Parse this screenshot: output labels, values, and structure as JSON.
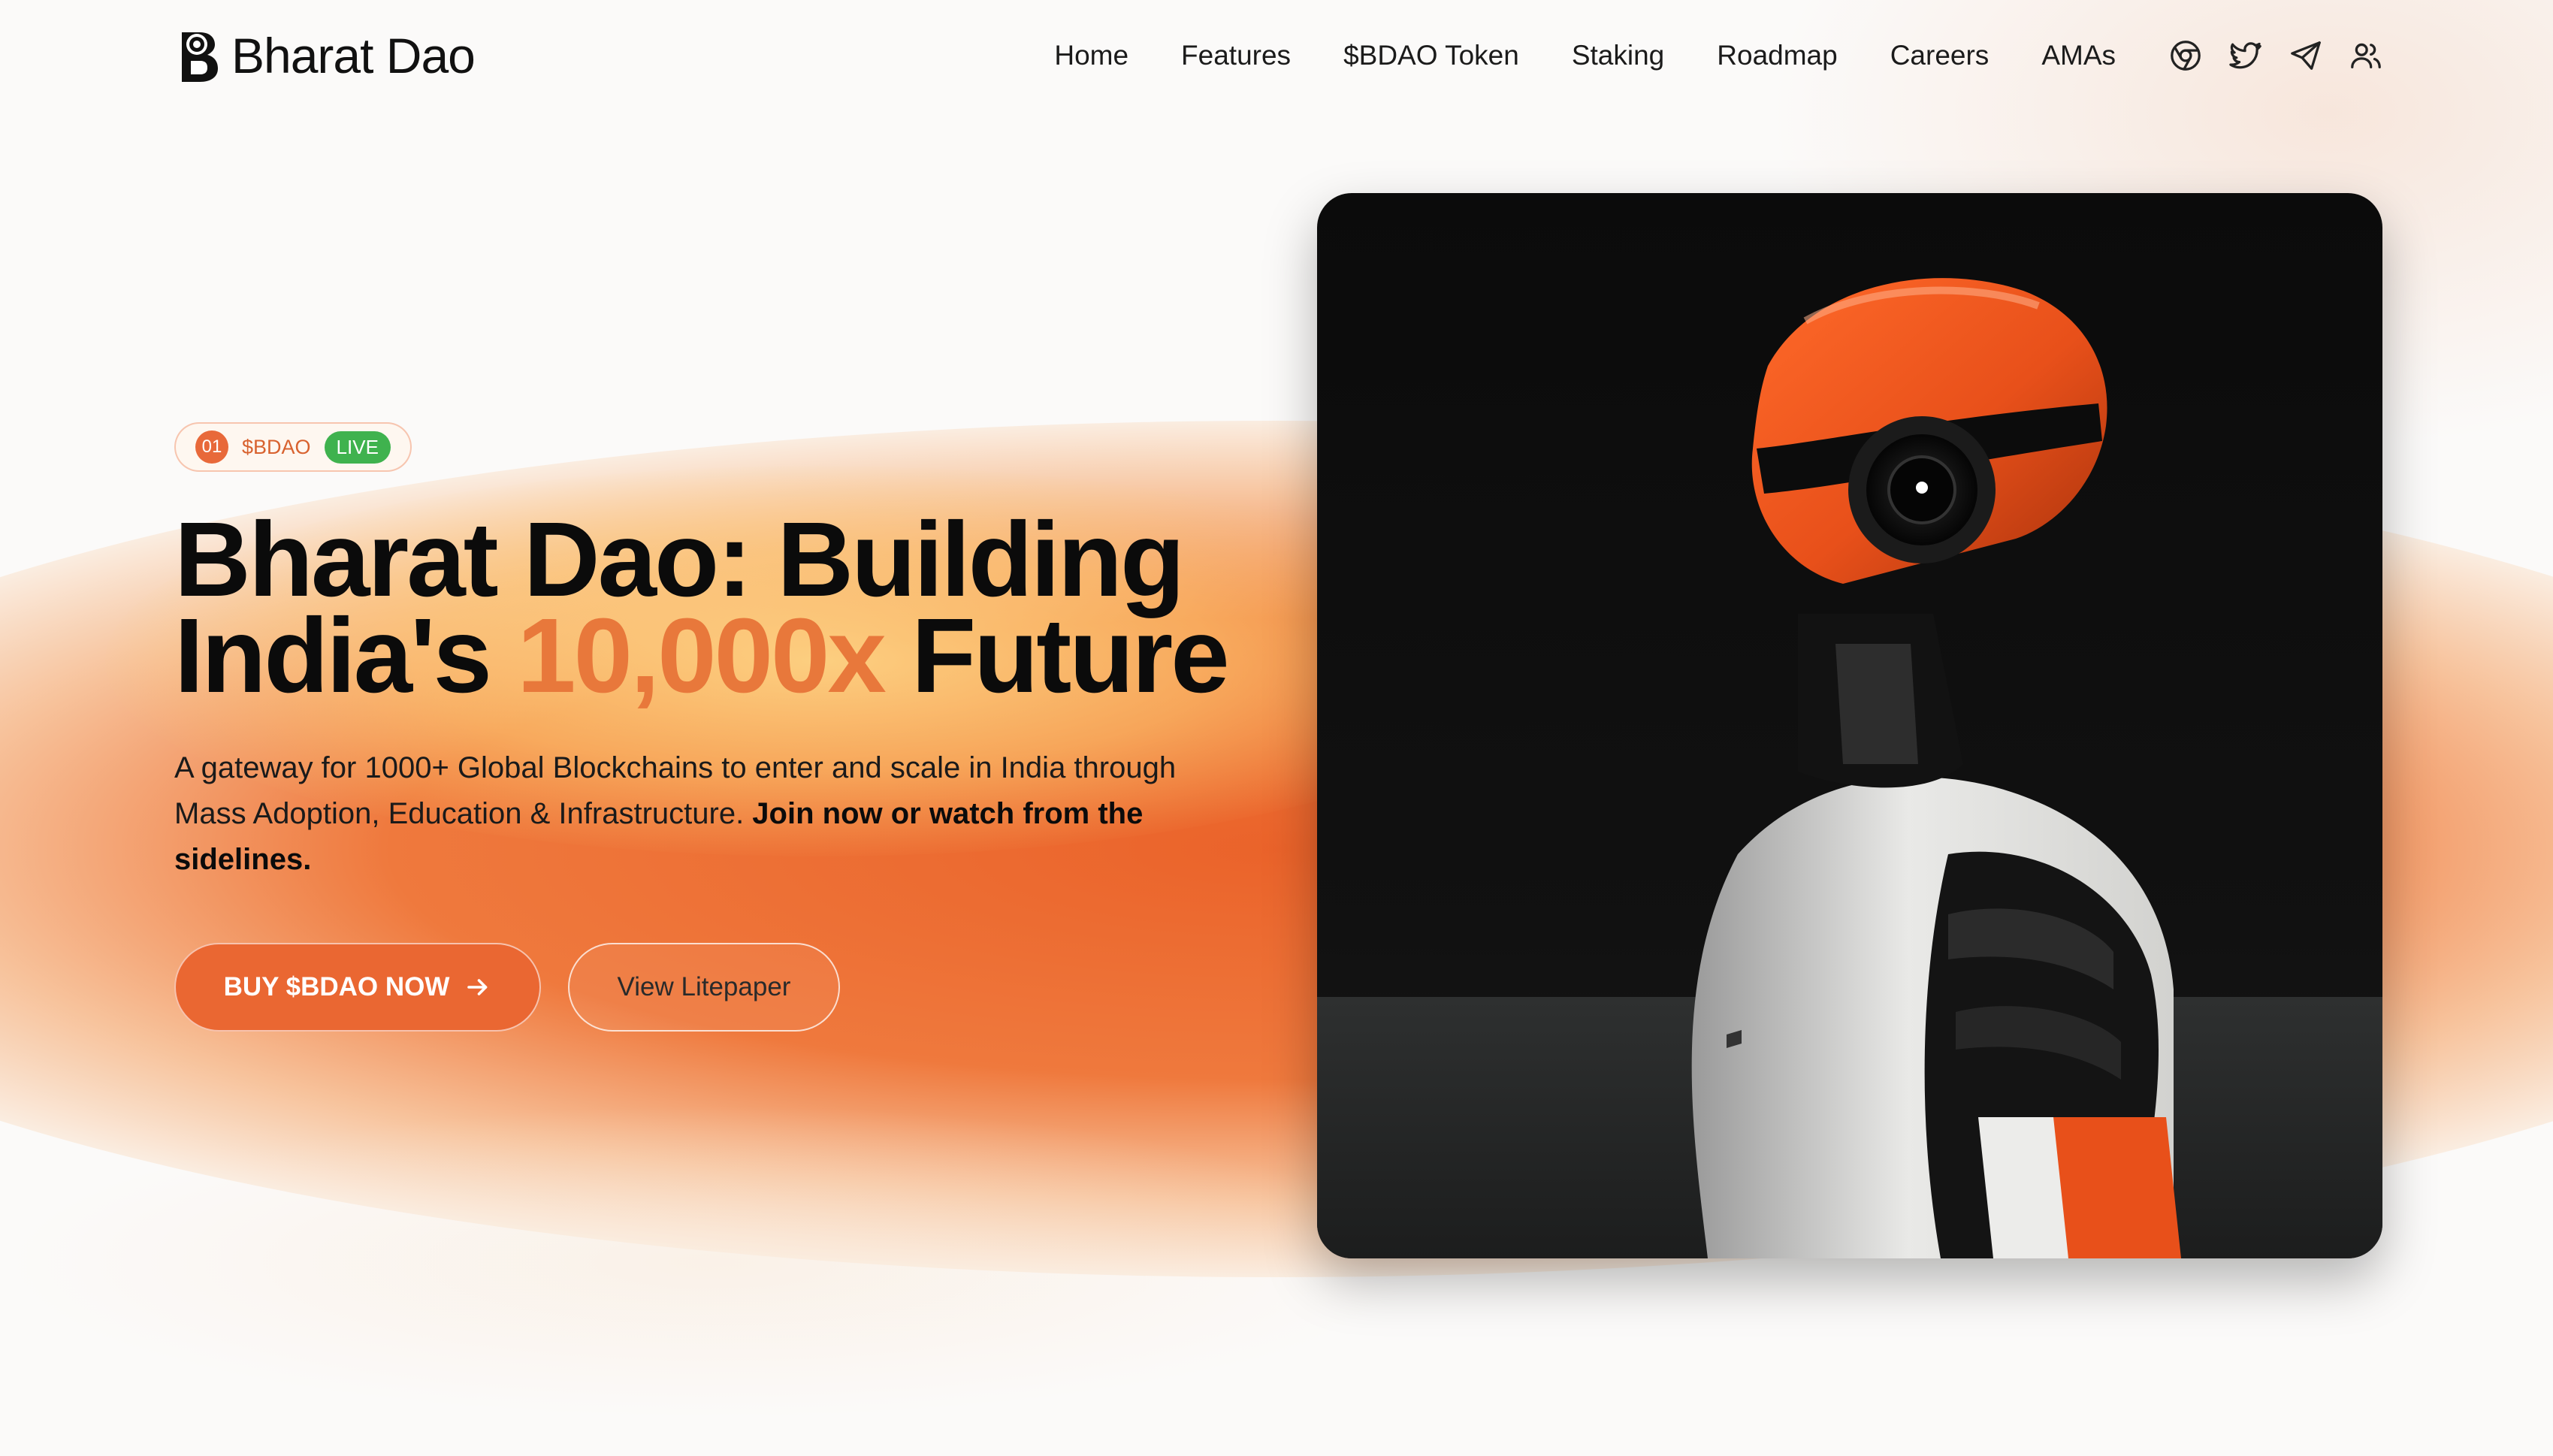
{
  "brand": {
    "name": "Bharat Dao"
  },
  "nav": {
    "items": [
      {
        "label": "Home"
      },
      {
        "label": "Features"
      },
      {
        "label": "$BDAO Token"
      },
      {
        "label": "Staking"
      },
      {
        "label": "Roadmap"
      },
      {
        "label": "Careers"
      },
      {
        "label": "AMAs"
      }
    ],
    "icons": [
      "chrome-icon",
      "twitter-icon",
      "telegram-icon",
      "users-icon"
    ]
  },
  "hero": {
    "badge": {
      "number": "01",
      "token": "$BDAO",
      "status": "LIVE"
    },
    "headline": {
      "line1": "Bharat Dao: Building",
      "line2_start": "India's ",
      "line2_accent": "10,000x",
      "line2_end": " Future"
    },
    "subtext": "A gateway for 1000+ Global Blockchains to enter and scale in India through Mass Adoption, Education & Infrastructure. ",
    "subtext_bold": "Join now or watch from the sidelines.",
    "cta_primary": "BUY $BDAO NOW",
    "cta_secondary": "View Litepaper"
  },
  "colors": {
    "accent": "#ea6732",
    "headline_accent": "#e8783b",
    "live_badge": "#3fb24e"
  }
}
